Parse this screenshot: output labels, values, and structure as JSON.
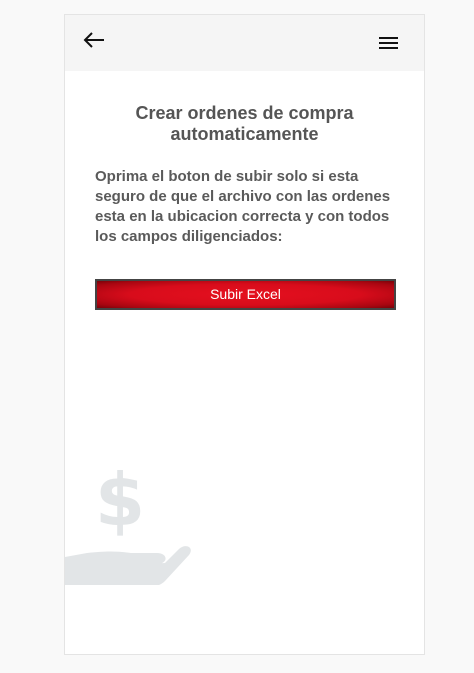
{
  "header": {
    "back_icon": "arrow-left-icon",
    "menu_icon": "hamburger-menu-icon"
  },
  "main": {
    "title": "Crear ordenes de compra automaticamente",
    "message": "Oprima el boton de subir solo si esta seguro de que el archivo con las ordenes esta en la ubicacion correcta y con todos los campos diligenciados:",
    "upload_button_label": "Subir Excel",
    "illustration_icon": "hand-dollar-icon"
  },
  "colors": {
    "topbar": "#f5f5f5",
    "title_text": "#555555",
    "button_red": "#d80c1b",
    "illustration": "#e2e5e7"
  }
}
